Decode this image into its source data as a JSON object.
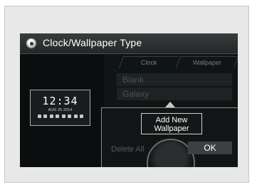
{
  "header": {
    "title": "Clock/Wallpaper Type",
    "title_icon": "settings-dial-icon"
  },
  "preview": {
    "time": "12:34",
    "date": "AUG 25 2014"
  },
  "tabs": [
    {
      "label": "Clock"
    },
    {
      "label": "Wallpaper"
    }
  ],
  "list": {
    "items": [
      {
        "label": "Blank"
      },
      {
        "label": "Galaxy"
      }
    ]
  },
  "popup": {
    "add_new_label": "Add New\nWallpaper",
    "delete_all_label": "Delete All",
    "ok_label": "OK"
  },
  "colors": {
    "screen_bg": "#0f1414",
    "title_text": "#ffffff",
    "dim_text": "#4c5152"
  }
}
